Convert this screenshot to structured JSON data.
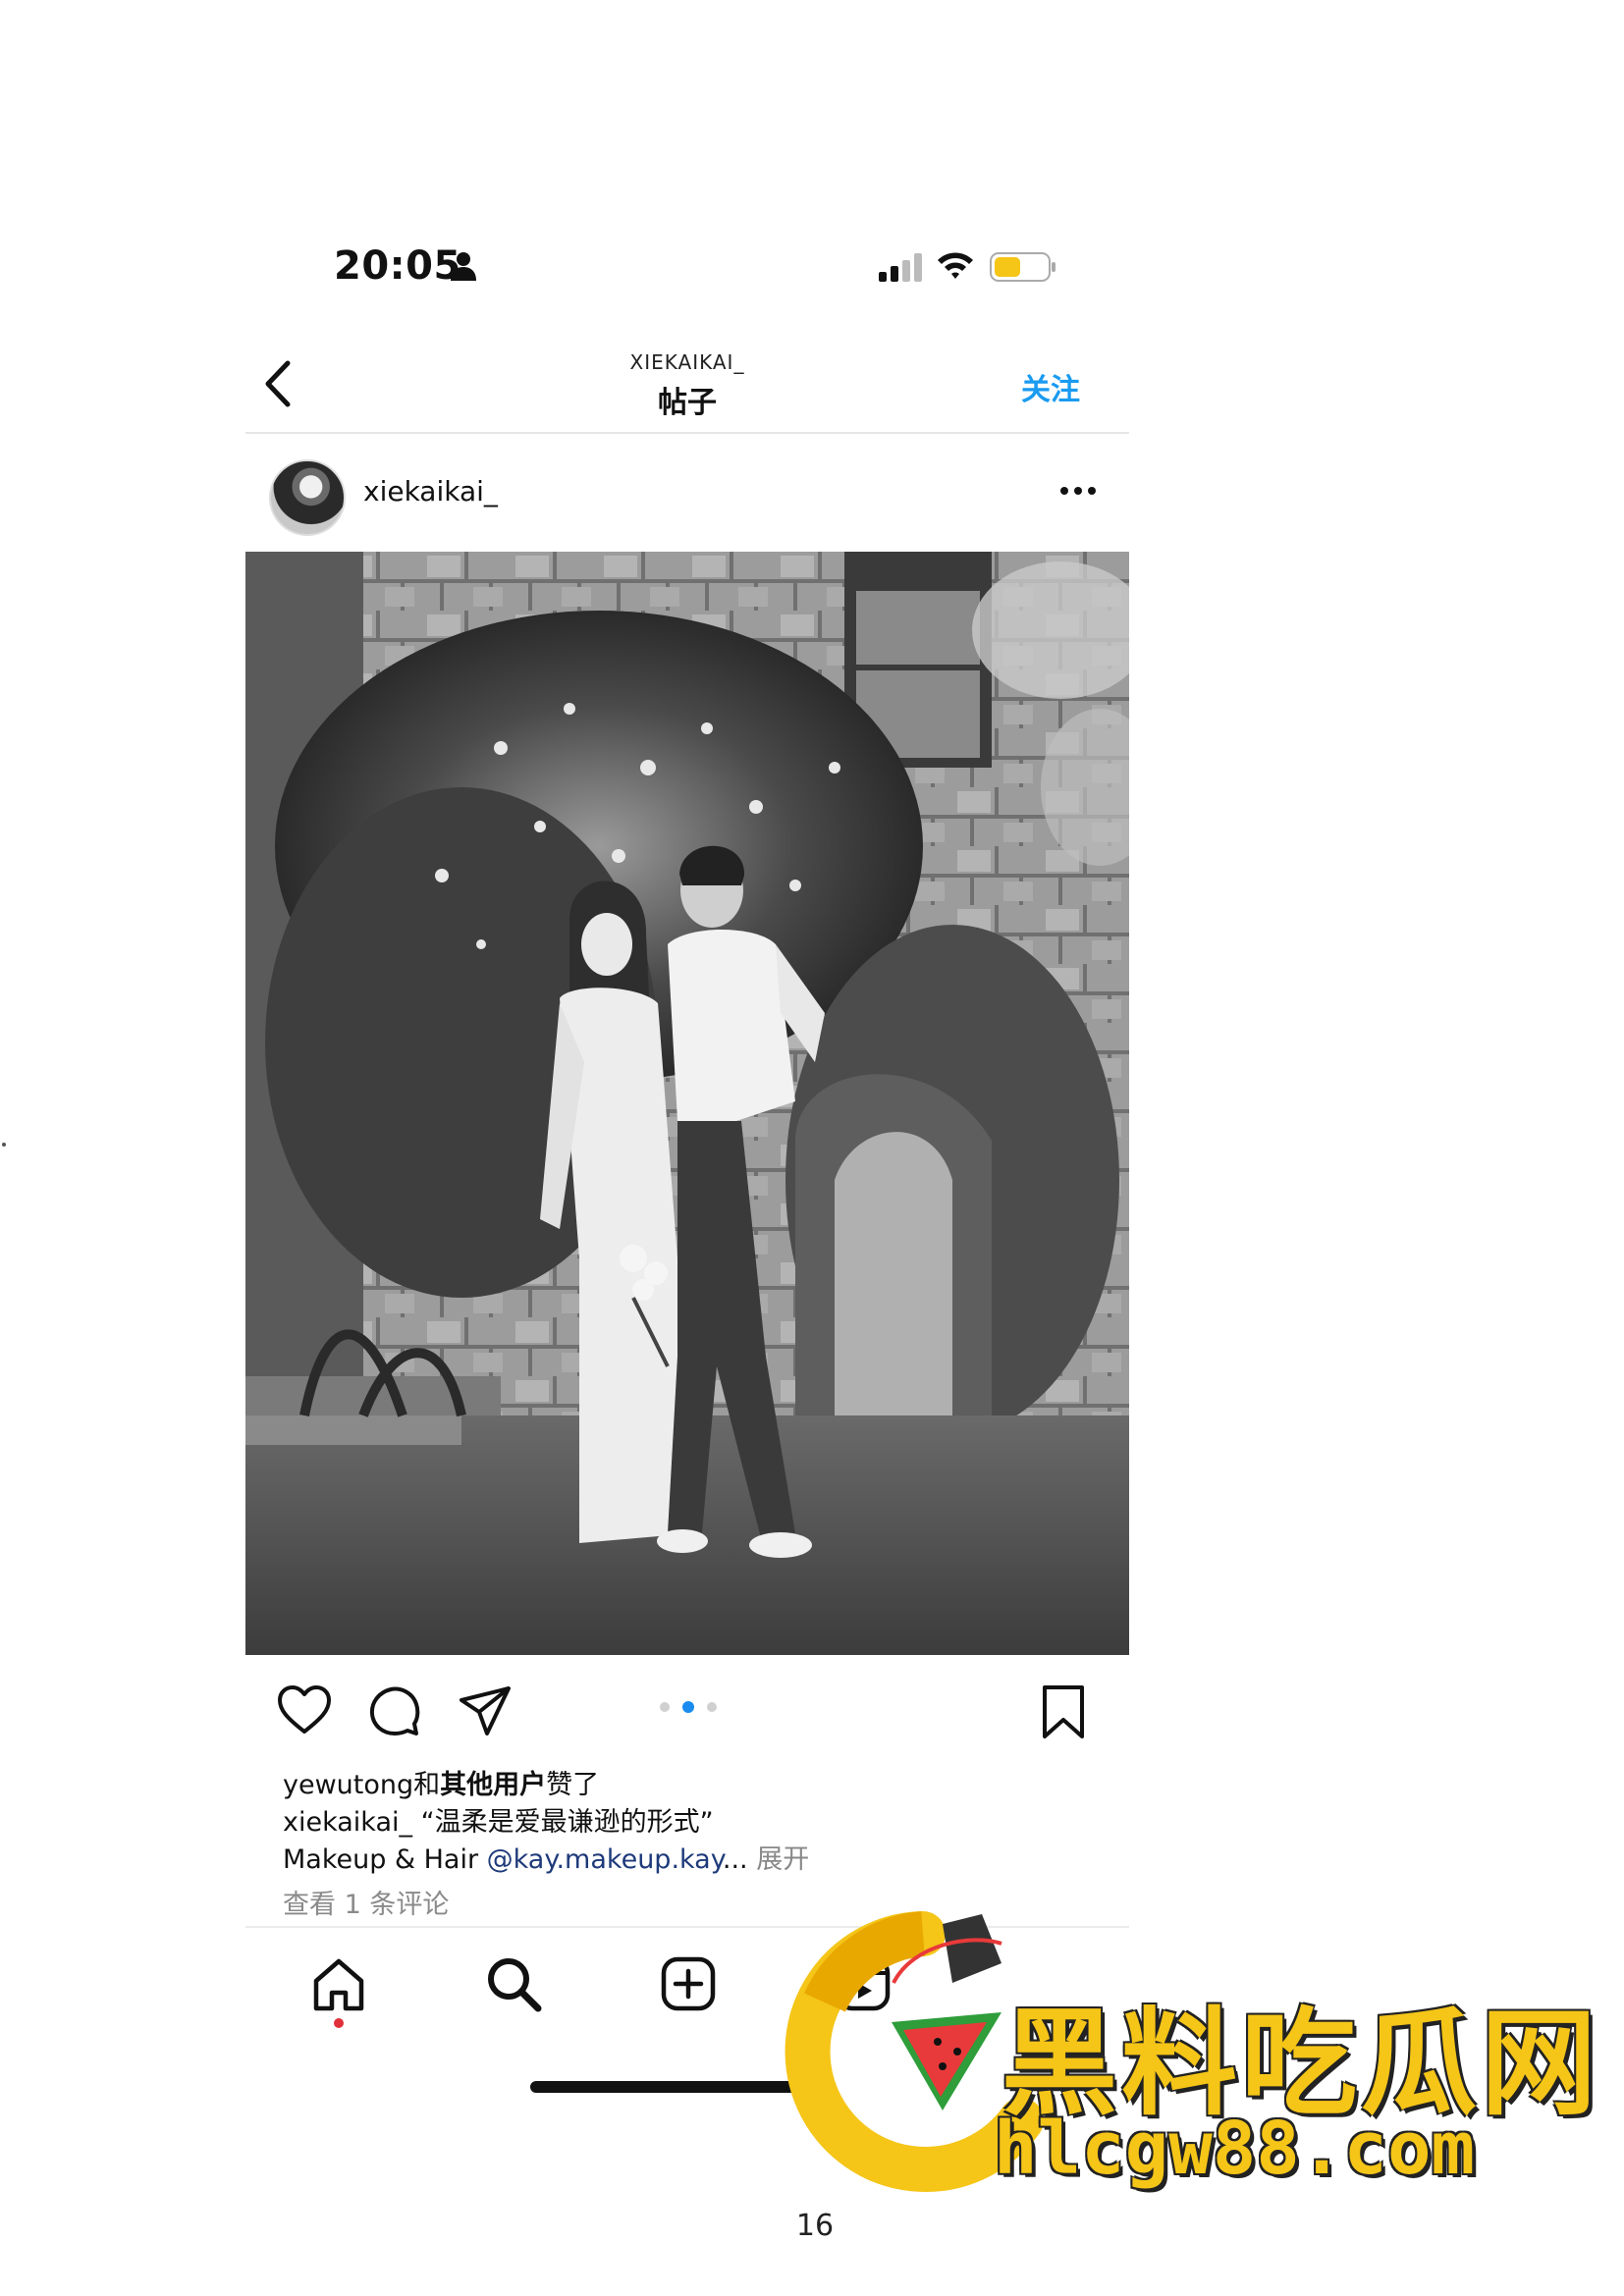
{
  "status_bar": {
    "time": "20:05",
    "icons": [
      "person-icon",
      "signal-icon",
      "wifi-icon",
      "battery-icon"
    ],
    "battery_color": "#f5c518"
  },
  "nav": {
    "back_icon": "chevron-left-icon",
    "subtitle": "XIEKAIKAI_",
    "title": "帖子",
    "follow_label": "关注",
    "follow_color": "#1a9bf0"
  },
  "post": {
    "username": "xiekaikai_",
    "more_icon": "more-horizontal-icon",
    "carousel": {
      "count": 3,
      "active_index": 1
    },
    "likes": {
      "user": "yewutong",
      "connector": "和",
      "others": "其他用户",
      "suffix": "赞了"
    },
    "caption": {
      "user": "xiekaikai_",
      "text": "“温柔是爱最谦逊的形式”"
    },
    "credit": {
      "prefix": "Makeup & Hair ",
      "mention": "@kay.makeup.kay",
      "ellipsis": "...",
      "expand": " 展开"
    },
    "comments_link": "查看 1 条评论"
  },
  "tab_bar": {
    "items": [
      "home-icon",
      "search-icon",
      "add-post-icon",
      "reels-icon"
    ],
    "home_dot_color": "#e0303a"
  },
  "watermark": {
    "title": "黑料吃瓜网",
    "domain": "hlcgw88.com",
    "color": "#f5c518"
  },
  "page_number": "16"
}
